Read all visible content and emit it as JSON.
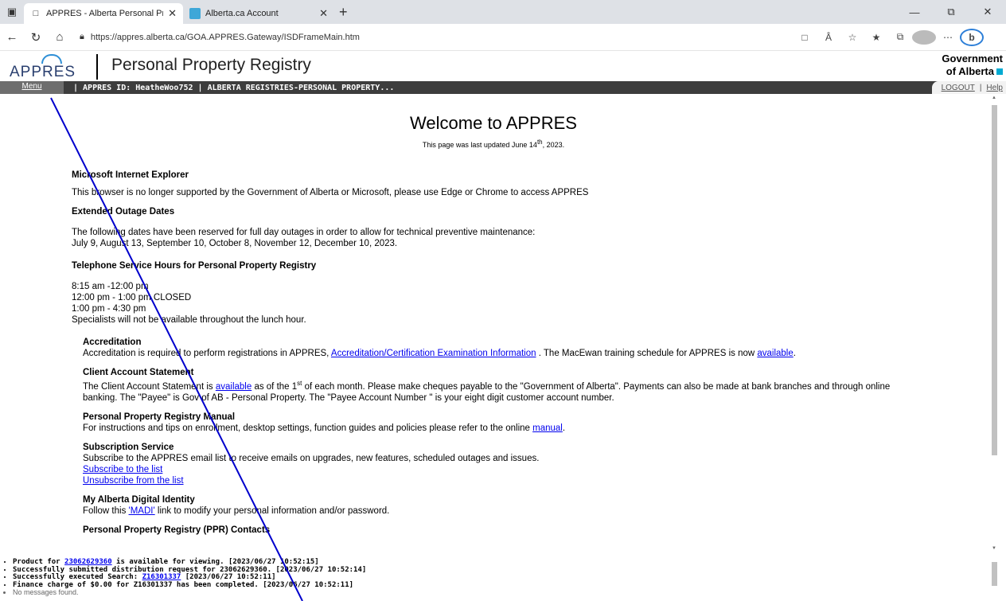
{
  "browser": {
    "tabs": [
      {
        "label": "APPRES - Alberta Personal Prope",
        "active": true
      },
      {
        "label": "Alberta.ca Account",
        "active": false
      }
    ],
    "new_tab": "+",
    "url": "https://appres.alberta.ca/GOA.APPRES.Gateway/ISDFrameMain.htm"
  },
  "header": {
    "logo_text": "APPRES",
    "title": "Personal Property Registry",
    "gov_line1": "Government",
    "gov_line2": "of Alberta"
  },
  "menubar": {
    "menu": "Menu",
    "info": "| APPRES ID: HeatheWoo752 | ALBERTA REGISTRIES-PERSONAL PROPERTY...",
    "logout": "LOGOUT",
    "sep": "|",
    "help": "Help"
  },
  "content": {
    "welcome": "Welcome to APPRES",
    "updated_prefix": "This page was last updated June 14",
    "updated_sup": "th",
    "updated_suffix": ", 2023.",
    "ie_title": "Microsoft Internet Explorer",
    "ie_text": "This browser is no longer supported by the Government of Alberta or Microsoft, please use Edge or Chrome to access APPRES",
    "outage_title": "Extended Outage Dates",
    "outage_line1": "The following dates have been reserved for full day outages in order to allow for technical preventive maintenance:",
    "outage_line2": "July 9, August 13, September 10, October 8, November 12, December 10, 2023.",
    "phone_title": "Telephone Service Hours for Personal Property Registry",
    "phone_lines": [
      "8:15 am -12:00 pm",
      "12:00 pm - 1:00 pm CLOSED",
      "1:00 pm - 4:30 pm",
      "Specialists will not be available throughout the lunch hour."
    ],
    "accred_title": "Accreditation",
    "accred_text1": "Accreditation is required to perform registrations in APPRES, ",
    "accred_link1": "Accreditation/Certification Examination Information",
    "accred_text2": " . The MacEwan training schedule for APPRES is now ",
    "accred_link2": "available",
    "accred_text3": ".",
    "cas_title": "Client Account Statement",
    "cas_text1": "The Client Account Statement is ",
    "cas_link": "available",
    "cas_text2": " as of the 1",
    "cas_sup": "st",
    "cas_text3": " of each month. Please make cheques payable to the \"Government of Alberta\". Payments can also be made at bank branches and through online banking. The \"Payee\" is Gov of AB - Personal Property. The \"Payee Account Number \" is your eight digit customer account number.",
    "manual_title": "Personal Property Registry Manual",
    "manual_text": "For instructions and tips on enrollment, desktop settings, function guides and policies please refer to the online ",
    "manual_link": "manual",
    "manual_end": ".",
    "sub_title": "Subscription Service",
    "sub_text": "Subscribe to the APPRES email list to receive emails on upgrades, new features, scheduled outages and issues.",
    "sub_link1": "Subscribe to the list",
    "sub_link2": "Unsubscribe from the list",
    "madi_title": "My Alberta Digital Identity",
    "madi_text1": "Follow this ",
    "madi_link": "'MADI'",
    "madi_text2": " link to modify your personal information and/or password.",
    "ppr_title": "Personal Property Registry (PPR) Contacts"
  },
  "messages": [
    {
      "pre": "Product for ",
      "link": "23062629360",
      "post": " is available for viewing. [2023/06/27 10:52:15]"
    },
    {
      "pre": "Successfully submitted distribution request for 23062629360. [2023/06/27 10:52:14]",
      "link": "",
      "post": ""
    },
    {
      "pre": "Successfully executed Search: ",
      "link": "Z16301337",
      "post": " [2023/06/27 10:52:11]"
    },
    {
      "pre": "Finance charge of $0.00 for Z16301337 has been completed. [2023/06/27 10:52:11]",
      "link": "",
      "post": ""
    },
    {
      "pre": "No messages found.",
      "link": "",
      "post": ""
    }
  ],
  "colors": {
    "annotation_line": "#0000cc",
    "gov_square": "#00aad2",
    "menubar": "#3d3d3d"
  }
}
